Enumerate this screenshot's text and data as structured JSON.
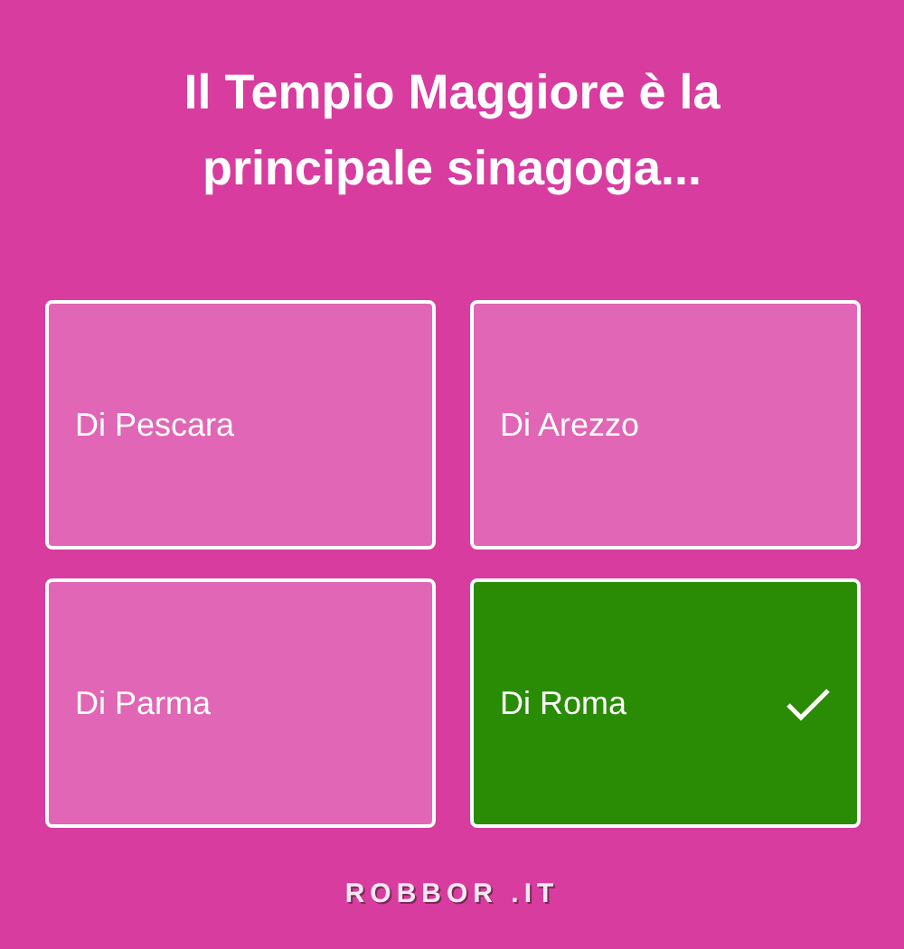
{
  "question": "Il Tempio Maggiore è la principale sinagoga...",
  "answers": [
    {
      "label": "Di Pescara",
      "selected": false
    },
    {
      "label": "Di Arezzo",
      "selected": false
    },
    {
      "label": "Di Parma",
      "selected": false
    },
    {
      "label": "Di Roma",
      "selected": true
    }
  ],
  "footer_logo": "ROBBOR .IT"
}
